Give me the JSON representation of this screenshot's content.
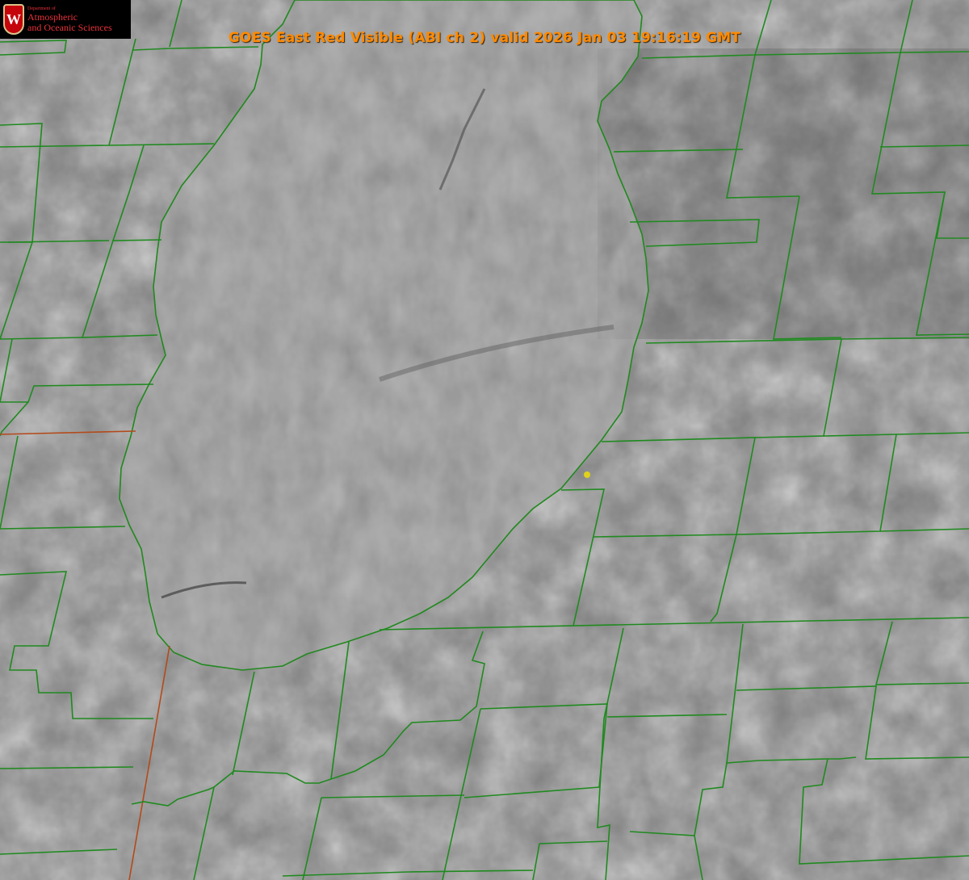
{
  "header": {
    "title": "GOES East Red Visible (ABI ch 2) valid 2026 Jan 03 19:16:19 GMT"
  },
  "logo": {
    "crest_letter": "W",
    "department_line": "Department of",
    "name_line_1": "Atmospheric",
    "name_line_2": "and Oceanic Sciences"
  },
  "map": {
    "imagery": "satellite-visible-grayscale",
    "boundary_color": "#1f8a1f",
    "shoreline_color": "#ff3030",
    "marker_color": "#e0d21a"
  }
}
